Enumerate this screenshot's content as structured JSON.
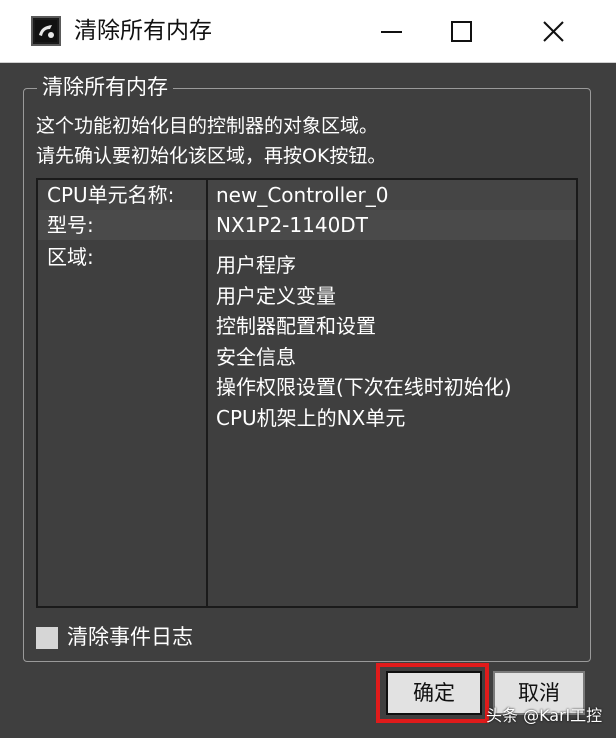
{
  "window": {
    "title": "清除所有内存",
    "icon": "app-logo-icon",
    "controls": {
      "minimize": "minimize-icon",
      "maximize": "maximize-icon",
      "close": "close-icon"
    }
  },
  "group": {
    "legend": "清除所有内存",
    "description_line1": "这个功能初始化目的控制器的对象区域。",
    "description_line2": "请先确认要初始化该区域，再按OK按钮。"
  },
  "info": {
    "rows": [
      {
        "label": "CPU单元名称:",
        "value": "new_Controller_0"
      },
      {
        "label": "型号:",
        "value": "NX1P2-1140DT"
      }
    ],
    "region_label": "区域:",
    "regions": [
      "用户程序",
      "用户定义变量",
      "控制器配置和设置",
      "安全信息",
      "操作权限设置(下次在线时初始化)",
      "CPU机架上的NX单元"
    ]
  },
  "options": {
    "clear_event_log_label": "清除事件日志",
    "clear_event_log_checked": false
  },
  "buttons": {
    "ok_label": "确定",
    "cancel_label": "取消"
  },
  "annotation": {
    "highlight_color": "#e01b1b"
  },
  "watermark": "头条 @Karl工控",
  "colors": {
    "background": "#3f3f3f",
    "titlebar": "#ffffff",
    "text": "#ffffff"
  }
}
